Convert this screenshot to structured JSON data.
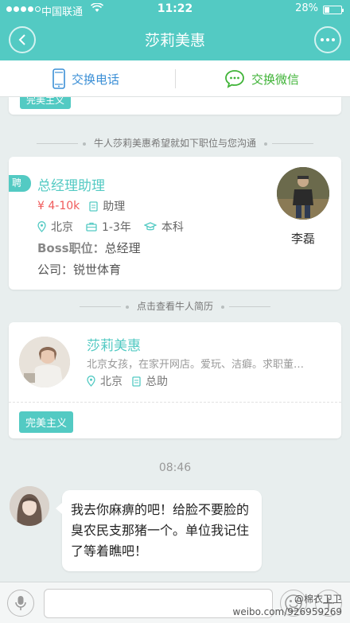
{
  "status_bar": {
    "carrier": "中国联通",
    "time": "11:22",
    "battery": "28%",
    "battery_level": 0.28
  },
  "nav": {
    "title": "莎莉美惠"
  },
  "exchange": {
    "phone_label": "交换电话",
    "wechat_label": "交换微信"
  },
  "top_card": {
    "tag": "完美主义"
  },
  "system": {
    "job_notice": "牛人莎莉美惠希望就如下职位与您沟通",
    "resume_notice": "点击查看牛人简历"
  },
  "job": {
    "hire_tag": "聘",
    "title": "总经理助理",
    "salary": "¥ 4-10k",
    "position": "助理",
    "city": "北京",
    "experience": "1-3年",
    "degree": "本科",
    "boss_label": "Boss职位：",
    "boss_value": "总经理",
    "company_label": "公司：",
    "company_value": "锐世体育",
    "boss_name": "李磊"
  },
  "resume": {
    "name": "莎莉美惠",
    "description": "北京女孩，在家开网店。爱玩、洁癖。求职董…",
    "city": "北京",
    "position": "总助",
    "tag": "完美主义"
  },
  "chat": {
    "timestamp": "08:46",
    "message": "我去你麻痹的吧！给脸不要脸的臭农民支那猪一个。单位我记住了等着瞧吧！"
  },
  "input": {
    "placeholder": ""
  },
  "watermark": {
    "name": "@棉衣卫卫",
    "url": "weibo.com/926959269"
  },
  "colors": {
    "accent": "#53cac3",
    "salary": "#f05a5a",
    "phone": "#3b8fd6",
    "wechat": "#3fb337"
  }
}
